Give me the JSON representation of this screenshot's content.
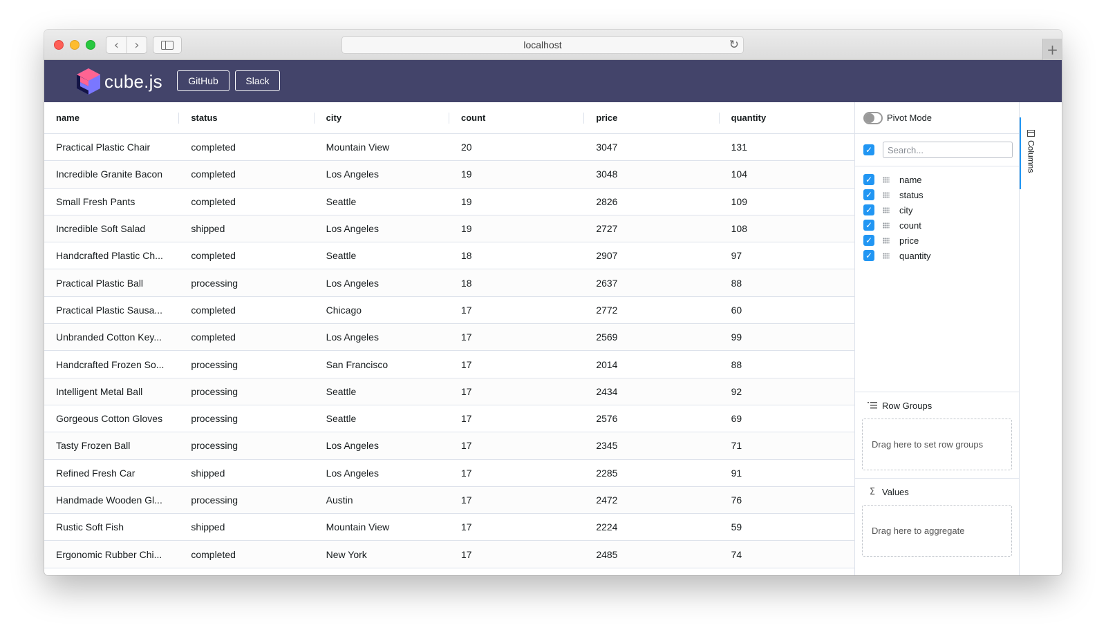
{
  "browser": {
    "url": "localhost",
    "back_glyph": "‹",
    "forward_glyph": "›",
    "reload_glyph": "↻",
    "newtab_glyph": "+"
  },
  "header": {
    "logo_text": "cube.js",
    "github_label": "GitHub",
    "slack_label": "Slack",
    "background_color": "#43446a"
  },
  "grid": {
    "columns": [
      "name",
      "status",
      "city",
      "count",
      "price",
      "quantity"
    ],
    "rows": [
      [
        "Practical Plastic Chair",
        "completed",
        "Mountain View",
        "20",
        "3047",
        "131"
      ],
      [
        "Incredible Granite Bacon",
        "completed",
        "Los Angeles",
        "19",
        "3048",
        "104"
      ],
      [
        "Small Fresh Pants",
        "completed",
        "Seattle",
        "19",
        "2826",
        "109"
      ],
      [
        "Incredible Soft Salad",
        "shipped",
        "Los Angeles",
        "19",
        "2727",
        "108"
      ],
      [
        "Handcrafted Plastic Ch...",
        "completed",
        "Seattle",
        "18",
        "2907",
        "97"
      ],
      [
        "Practical Plastic Ball",
        "processing",
        "Los Angeles",
        "18",
        "2637",
        "88"
      ],
      [
        "Practical Plastic Sausa...",
        "completed",
        "Chicago",
        "17",
        "2772",
        "60"
      ],
      [
        "Unbranded Cotton Key...",
        "completed",
        "Los Angeles",
        "17",
        "2569",
        "99"
      ],
      [
        "Handcrafted Frozen So...",
        "processing",
        "San Francisco",
        "17",
        "2014",
        "88"
      ],
      [
        "Intelligent Metal Ball",
        "processing",
        "Seattle",
        "17",
        "2434",
        "92"
      ],
      [
        "Gorgeous Cotton Gloves",
        "processing",
        "Seattle",
        "17",
        "2576",
        "69"
      ],
      [
        "Tasty Frozen Ball",
        "processing",
        "Los Angeles",
        "17",
        "2345",
        "71"
      ],
      [
        "Refined Fresh Car",
        "shipped",
        "Los Angeles",
        "17",
        "2285",
        "91"
      ],
      [
        "Handmade Wooden Gl...",
        "processing",
        "Austin",
        "17",
        "2472",
        "76"
      ],
      [
        "Rustic Soft Fish",
        "shipped",
        "Mountain View",
        "17",
        "2224",
        "59"
      ],
      [
        "Ergonomic Rubber Chi...",
        "completed",
        "New York",
        "17",
        "2485",
        "74"
      ]
    ]
  },
  "tool_panel": {
    "pivot_mode_label": "Pivot Mode",
    "pivot_mode_on": false,
    "search_placeholder": "Search...",
    "column_items": [
      "name",
      "status",
      "city",
      "count",
      "price",
      "quantity"
    ],
    "row_groups_label": "Row Groups",
    "row_groups_icon": "row-groups-icon",
    "row_groups_drop_text": "Drag here to set row groups",
    "values_label": "Values",
    "values_icon_glyph": "Σ",
    "values_drop_text": "Drag here to aggregate",
    "side_tab_label": "Columns",
    "accent_color": "#2196f3"
  }
}
